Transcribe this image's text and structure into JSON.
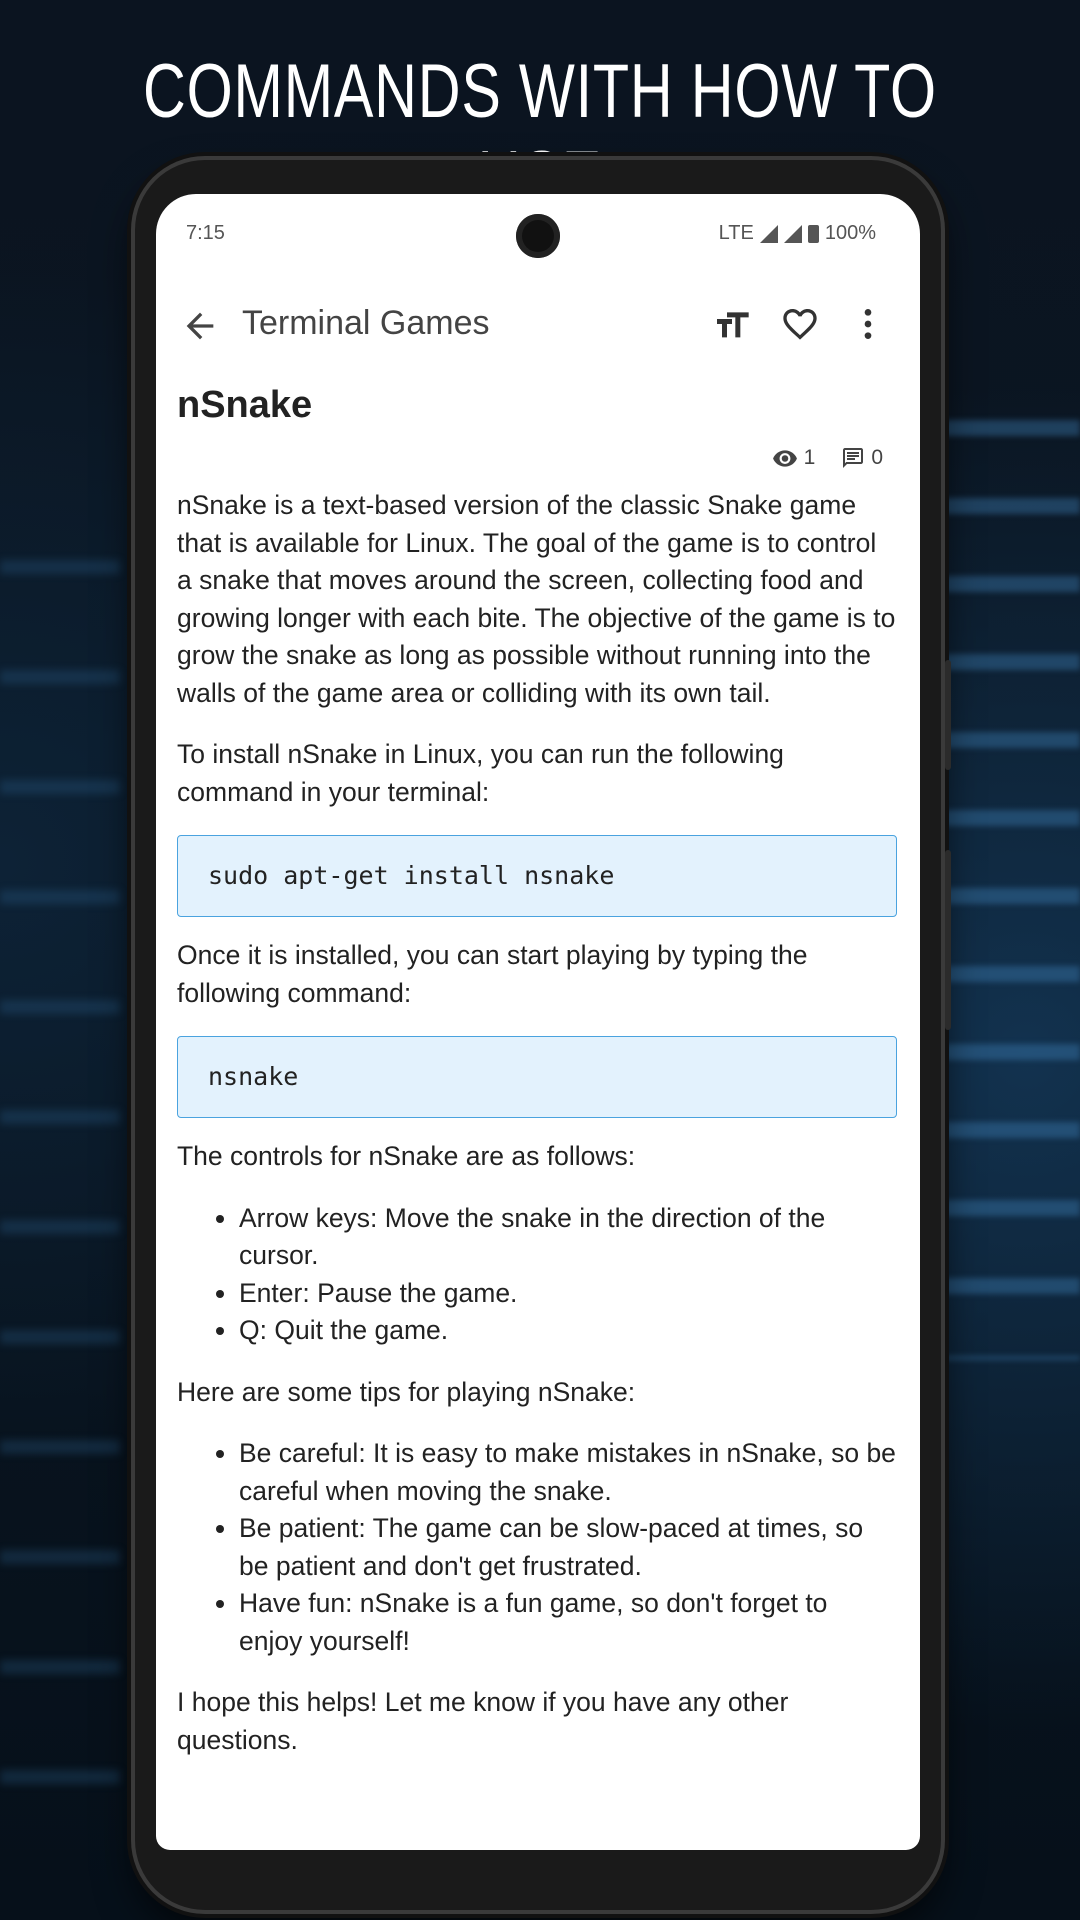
{
  "headline": "COMMANDS WITH HOW TO USE",
  "status_bar": {
    "time": "7:15",
    "network": "LTE",
    "battery": "100%"
  },
  "app_bar": {
    "title": "Terminal Games"
  },
  "article": {
    "title": "nSnake",
    "views": "1",
    "comments": "0",
    "intro": "nSnake is a text-based version of the classic Snake game that is available for Linux. The goal of the game is to control a snake that moves around the screen, collecting food and growing longer with each bite. The objective of the game is to grow the snake as long as possible without running into the walls of the game area or colliding with its own tail.",
    "install_text": "To install nSnake in Linux, you can run the following command in your terminal:",
    "install_cmd": "sudo apt-get install nsnake",
    "run_text": "Once it is installed, you can start playing by typing the following command:",
    "run_cmd": "nsnake",
    "controls_text": "The controls for nSnake are as follows:",
    "controls": [
      "Arrow keys: Move the snake in the direction of the cursor.",
      "Enter: Pause the game.",
      "Q: Quit the game."
    ],
    "tips_text": "Here are some tips for playing nSnake:",
    "tips": [
      "Be careful: It is easy to make mistakes in nSnake, so be careful when moving the snake.",
      "Be patient: The game can be slow-paced at times, so be patient and don't get frustrated.",
      "Have fun: nSnake is a fun game, so don't forget to enjoy yourself!"
    ],
    "closing": "I hope this helps! Let me know if you have any other questions."
  },
  "icons": {
    "back": "arrow-back-icon",
    "text_size": "text-size-icon",
    "favorite": "heart-icon",
    "more": "more-vert-icon",
    "views": "eye-icon",
    "comments": "comment-icon"
  },
  "colors": {
    "code_bg": "#e3f2fd",
    "code_border": "#4aa3df"
  }
}
